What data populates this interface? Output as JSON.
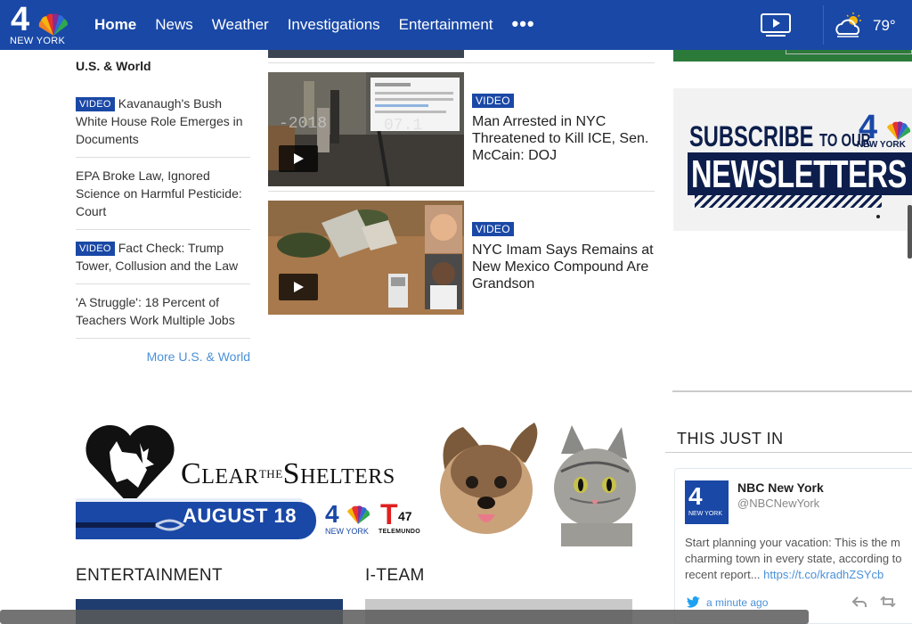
{
  "header": {
    "logo_number": "4",
    "logo_city": "NEW YORK",
    "nav": [
      "Home",
      "News",
      "Weather",
      "Investigations",
      "Entertainment"
    ],
    "more_icon": "more-dots-icon",
    "video_icon": "video-play-icon",
    "weather_icon": "partly-cloudy-icon",
    "temperature": "79°"
  },
  "left_column": {
    "section_title": "U.S. & World",
    "stories": [
      {
        "badge": "VIDEO",
        "title": "Kavanaugh's Bush White House Role Emerges in Documents"
      },
      {
        "badge": "",
        "title": "EPA Broke Law, Ignored Science on Harmful Pesticide: Court"
      },
      {
        "badge": "VIDEO",
        "title": "Fact Check: Trump Tower, Collusion and the Law"
      },
      {
        "badge": "",
        "title": "'A Struggle': 18 Percent of Teachers Work Multiple Jobs"
      }
    ],
    "more_link": "More U.S. & World"
  },
  "middle_column": {
    "cards": [
      {
        "badge": "VIDEO",
        "title": "Man Arrested in NYC Threatened to Kill ICE, Sen. McCain: DOJ"
      },
      {
        "badge": "VIDEO",
        "title": "NYC Imam Says Remains at New Mexico Compound Are Grandson"
      }
    ]
  },
  "newsletter_ad": {
    "line1": "SUBSCRIBE",
    "line1b": "TO OUR",
    "line2": "NEWSLETTERS",
    "logo_number": "4",
    "logo_city": "NEW YORK"
  },
  "this_just_in": {
    "title": "THIS JUST IN",
    "tweet": {
      "name": "NBC New York",
      "handle": "@NBCNewYork",
      "text_line1": "Start planning your vacation: This is the m",
      "text_line2": "charming town in every state, according to",
      "text_line3": "recent report...",
      "link": "https://t.co/kradhZSYcb",
      "time": "a minute ago",
      "avatar_number": "4",
      "avatar_city": "NEW YORK"
    }
  },
  "clear_the_shelters": {
    "title_c": "C",
    "title_lear": "LEAR",
    "title_the": "THE",
    "title_s": "S",
    "title_helters": "HELTERS",
    "date": "AUGUST 18",
    "nbc_number": "4",
    "nbc_city": "NEW YORK",
    "telemundo_t": "T",
    "telemundo_num": "47",
    "telemundo_label": "TELEMUNDO"
  },
  "sections": {
    "entertainment": "ENTERTAINMENT",
    "iteam": "I-TEAM"
  },
  "colors": {
    "brand_blue": "#1a48a6",
    "link_blue": "#4a90d9",
    "navy": "#0d1e4c"
  }
}
